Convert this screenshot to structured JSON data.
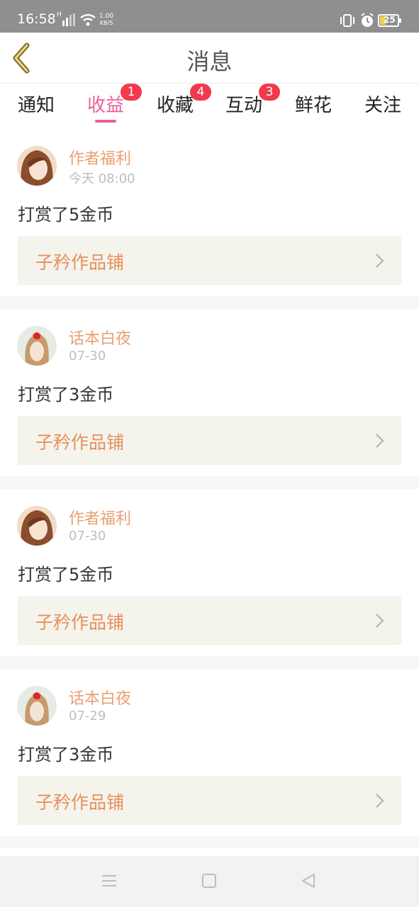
{
  "status_bar": {
    "time": "16:58",
    "network_type": "H",
    "speed_value": "1.00",
    "speed_unit": "KB/S",
    "battery": "25",
    "battery_color": "#f2d04a"
  },
  "header": {
    "title": "消息",
    "back_icon": "chevron-left-icon"
  },
  "tabs": [
    {
      "label": "通知",
      "badge": ""
    },
    {
      "label": "收益",
      "badge": "1",
      "active": true
    },
    {
      "label": "收藏",
      "badge": "4"
    },
    {
      "label": "互动",
      "badge": "3"
    },
    {
      "label": "鲜花",
      "badge": ""
    },
    {
      "label": "关注",
      "badge": ""
    }
  ],
  "colors": {
    "accent": "#e8609b",
    "badge": "#f23a4c",
    "name": "#e8a070",
    "shop_text": "#e8905c",
    "shop_bg": "#f4f4ed"
  },
  "messages": [
    {
      "name": "作者福利",
      "time": "今天 08:00",
      "text": "打赏了5金币",
      "shop": "子矜作品铺",
      "avatar": "girl-avatar-brown-hair"
    },
    {
      "name": "话本白夜",
      "time": "07-30",
      "text": "打赏了3金币",
      "shop": "子矜作品铺",
      "avatar": "girl-avatar-red-bow"
    },
    {
      "name": "作者福利",
      "time": "07-30",
      "text": "打赏了5金币",
      "shop": "子矜作品铺",
      "avatar": "girl-avatar-brown-hair"
    },
    {
      "name": "话本白夜",
      "time": "07-29",
      "text": "打赏了3金币",
      "shop": "子矜作品铺",
      "avatar": "girl-avatar-red-bow"
    }
  ],
  "nav_bar": {
    "menu_icon": "menu-icon",
    "home_icon": "home-square-icon",
    "back_icon": "back-triangle-icon"
  }
}
